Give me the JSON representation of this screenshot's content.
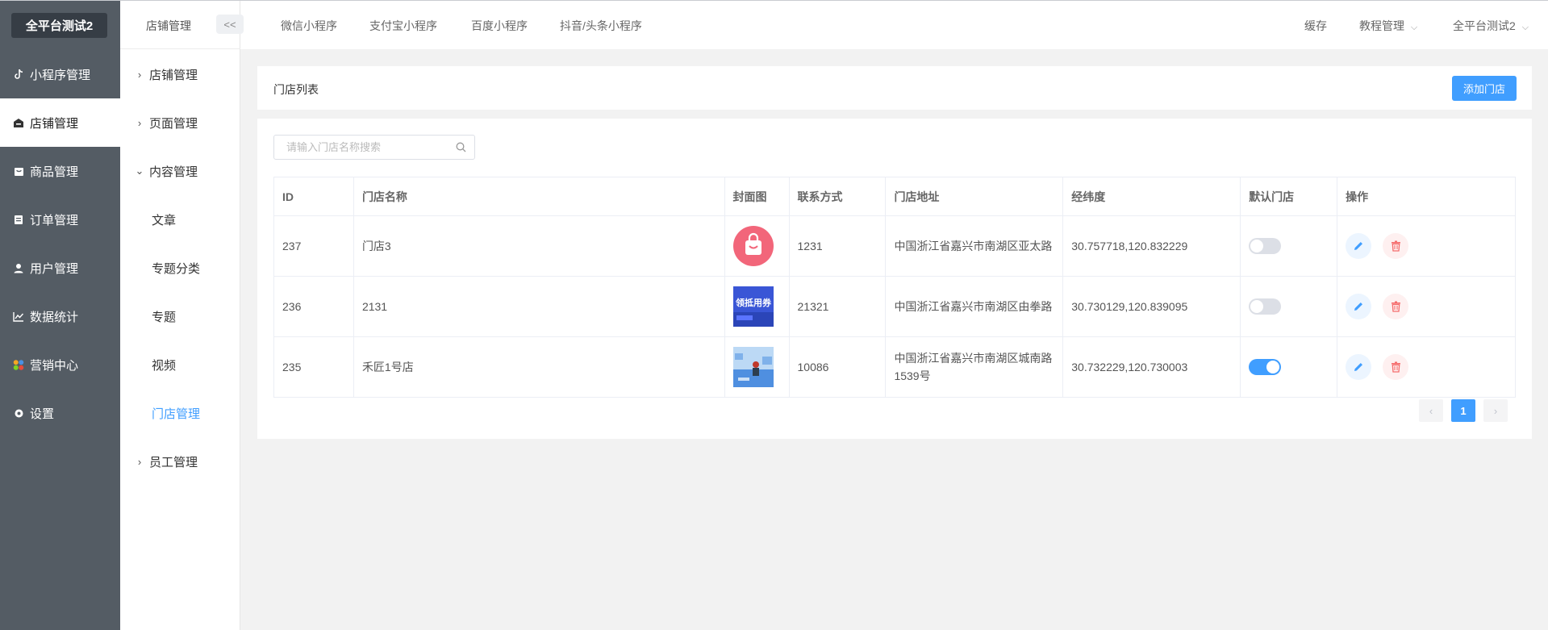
{
  "app": {
    "brand": "全平台测试2"
  },
  "sidebar": {
    "items": [
      {
        "label": "小程序管理",
        "icon": "tiktok-icon"
      },
      {
        "label": "店铺管理",
        "icon": "store-icon"
      },
      {
        "label": "商品管理",
        "icon": "bag-icon"
      },
      {
        "label": "订单管理",
        "icon": "order-icon"
      },
      {
        "label": "用户管理",
        "icon": "user-icon"
      },
      {
        "label": "数据统计",
        "icon": "chart-icon"
      },
      {
        "label": "营销中心",
        "icon": "marketing-icon"
      },
      {
        "label": "设置",
        "icon": "gear-icon"
      }
    ],
    "active": "店铺管理"
  },
  "subnav": {
    "title": "店铺管理",
    "collapse_label": "<<",
    "items": [
      {
        "label": "店铺管理"
      },
      {
        "label": "页面管理"
      },
      {
        "label": "内容管理",
        "children": [
          "文章",
          "专题分类",
          "专题",
          "视频",
          "门店管理"
        ]
      },
      {
        "label": "员工管理"
      }
    ],
    "active_child": "门店管理"
  },
  "header": {
    "tabs": [
      "微信小程序",
      "支付宝小程序",
      "百度小程序",
      "抖音/头条小程序"
    ],
    "right": {
      "cache": "缓存",
      "tutorial": "教程管理",
      "account": "全平台测试2"
    }
  },
  "panel": {
    "title": "门店列表",
    "add_button": "添加门店"
  },
  "search": {
    "placeholder": "请输入门店名称搜索"
  },
  "table": {
    "columns": [
      "ID",
      "门店名称",
      "封面图",
      "联系方式",
      "门店地址",
      "经纬度",
      "默认门店",
      "操作"
    ],
    "rows": [
      {
        "id": "237",
        "name": "门店3",
        "phone": "1231",
        "address": "中国浙江省嘉兴市南湖区亚太路",
        "coords": "30.757718,120.832229",
        "default": false,
        "cover": "shopping-bag-image"
      },
      {
        "id": "236",
        "name": "2131",
        "phone": "21321",
        "address": "中国浙江省嘉兴市南湖区由拳路",
        "coords": "30.730129,120.839095",
        "default": false,
        "cover": "banner-image",
        "cover_text": "领抵用券"
      },
      {
        "id": "235",
        "name": "禾匠1号店",
        "phone": "10086",
        "address": "中国浙江省嘉兴市南湖区城南路1539号",
        "coords": "30.732229,120.730003",
        "default": true,
        "cover": "scene-image"
      }
    ]
  },
  "pagination": {
    "current": "1",
    "prev": "‹",
    "next": "›"
  },
  "colors": {
    "primary": "#409eff",
    "sidebar": "#545c64",
    "brand_bg": "#363d45",
    "danger": "#f56c6c"
  }
}
